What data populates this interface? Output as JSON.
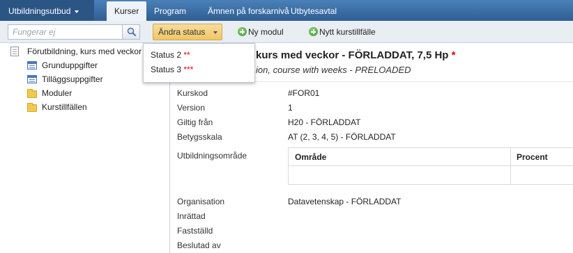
{
  "nav": {
    "menu_label": "Utbildningsutbud",
    "tabs": [
      {
        "label": "Kurser",
        "active": true
      },
      {
        "label": "Program",
        "active": false
      },
      {
        "label": "Ämnen på forskarnivå",
        "active": false
      },
      {
        "label": "Utbytesavtal",
        "active": false
      }
    ]
  },
  "toolbar": {
    "search_placeholder": "Fungerar ej",
    "status_button": "Ändra status",
    "new_module": "Ny modul",
    "new_instance": "Nytt kurstillfälle"
  },
  "dropdown": {
    "items": [
      {
        "label": "Status 2",
        "marker": "**"
      },
      {
        "label": "Status 3",
        "marker": "***"
      }
    ]
  },
  "tree": {
    "root": "Förutbildning, kurs med veckor",
    "children": [
      {
        "label": "Grunduppgifter",
        "icon": "form-icon"
      },
      {
        "label": "Tilläggsuppgifter",
        "icon": "form-icon"
      },
      {
        "label": "Moduler",
        "icon": "folder-icon"
      },
      {
        "label": "Kurstillfällen",
        "icon": "folder-icon"
      }
    ]
  },
  "course": {
    "title": "kurs med veckor - FÖRLADDAT, 7,5 Hp",
    "required_marker": "*",
    "subtitle": "ion, course with weeks - PRELOADED"
  },
  "fields": {
    "kurskod": {
      "label": "Kurskod",
      "value": "#FOR01"
    },
    "version": {
      "label": "Version",
      "value": "1"
    },
    "giltig": {
      "label": "Giltig från",
      "value": "H20 - FÖRLADDAT"
    },
    "betyg": {
      "label": "Betygsskala",
      "value": "AT (2, 3, 4, 5) - FÖRLADDAT"
    },
    "omrade": {
      "label": "Utbildningsområde"
    },
    "organisation": {
      "label": "Organisation",
      "value": "Datavetenskap - FÖRLADDAT"
    },
    "inrattad": {
      "label": "Inrättad"
    },
    "faststalld": {
      "label": "Fastställd"
    },
    "beslutad": {
      "label": "Beslutad av"
    }
  },
  "area_table": {
    "columns": [
      "Område",
      "Procent"
    ]
  },
  "colors": {
    "nav_bg": "#3a6ea5",
    "status_button": "#f0c767",
    "required": "#dd0000"
  }
}
